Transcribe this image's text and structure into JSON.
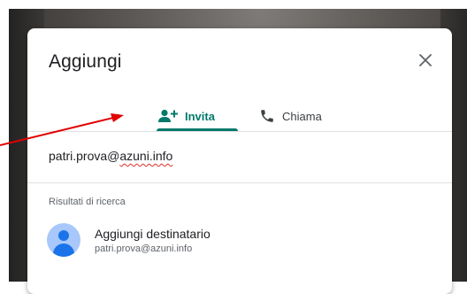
{
  "dialog": {
    "title": "Aggiungi",
    "close_icon": "close-icon"
  },
  "tabs": [
    {
      "label": "Invita",
      "icon": "person-add-icon",
      "active": true
    },
    {
      "label": "Chiama",
      "icon": "phone-icon",
      "active": false
    }
  ],
  "input": {
    "value_prefix": "patri.prova@",
    "value_domain": "azuni.info"
  },
  "results": {
    "section_label": "Risultati di ricerca",
    "items": [
      {
        "title": "Aggiungi destinatario",
        "subtitle": "patri.prova@azuni.info",
        "icon": "avatar-icon"
      }
    ]
  },
  "colors": {
    "accent": "#00796b",
    "avatar_bg": "#a8c7fa",
    "avatar_fg": "#1a73e8",
    "annotation_arrow": "#e00000"
  }
}
